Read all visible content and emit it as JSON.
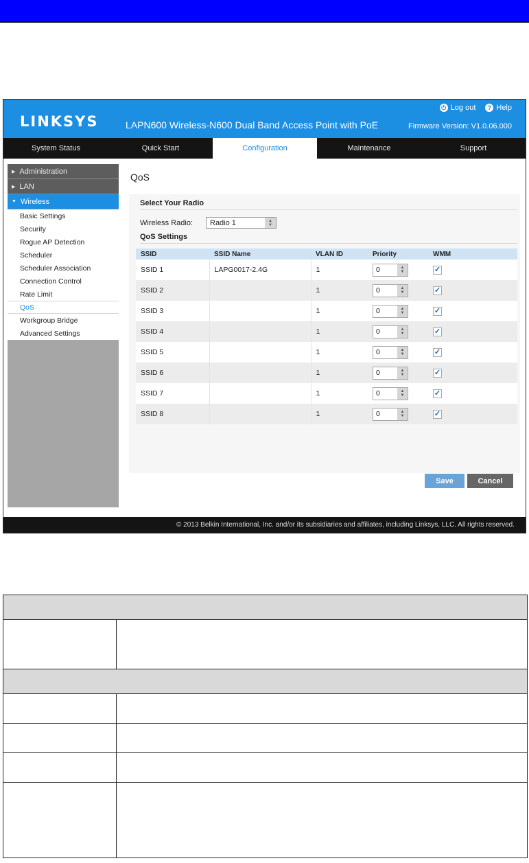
{
  "header": {
    "logo": "LINKSYS",
    "product_title": "LAPN600 Wireless-N600 Dual Band Access Point with PoE",
    "logout_label": "Log out",
    "help_label": "Help",
    "firmware": "Firmware Version: V1.0.06.000"
  },
  "nav": {
    "tabs": [
      "System Status",
      "Quick Start",
      "Configuration",
      "Maintenance",
      "Support"
    ],
    "active": "Configuration"
  },
  "sidebar": {
    "groups": [
      "Administration",
      "LAN",
      "Wireless"
    ],
    "items": [
      "Basic Settings",
      "Security",
      "Rogue AP Detection",
      "Scheduler",
      "Scheduler Association",
      "Connection Control",
      "Rate Limit",
      "QoS",
      "Workgroup Bridge",
      "Advanced Settings"
    ],
    "active_item": "QoS"
  },
  "main": {
    "page_title": "QoS",
    "select_radio_heading": "Select Your Radio",
    "wireless_radio_label": "Wireless Radio:",
    "wireless_radio_value": "Radio 1",
    "qos_heading": "QoS Settings",
    "columns": [
      "SSID",
      "SSID Name",
      "VLAN ID",
      "Priority",
      "WMM"
    ],
    "rows": [
      {
        "ssid": "SSID 1",
        "name": "LAPG0017-2.4G",
        "vlan": "1",
        "priority": "0",
        "wmm": true
      },
      {
        "ssid": "SSID 2",
        "name": "",
        "vlan": "1",
        "priority": "0",
        "wmm": true
      },
      {
        "ssid": "SSID 3",
        "name": "",
        "vlan": "1",
        "priority": "0",
        "wmm": true
      },
      {
        "ssid": "SSID 4",
        "name": "",
        "vlan": "1",
        "priority": "0",
        "wmm": true
      },
      {
        "ssid": "SSID 5",
        "name": "",
        "vlan": "1",
        "priority": "0",
        "wmm": true
      },
      {
        "ssid": "SSID 6",
        "name": "",
        "vlan": "1",
        "priority": "0",
        "wmm": true
      },
      {
        "ssid": "SSID 7",
        "name": "",
        "vlan": "1",
        "priority": "0",
        "wmm": true
      },
      {
        "ssid": "SSID 8",
        "name": "",
        "vlan": "1",
        "priority": "0",
        "wmm": true
      }
    ],
    "save_label": "Save",
    "cancel_label": "Cancel"
  },
  "footer": {
    "copyright": "© 2013 Belkin International, Inc. and/or its subsidiaries and affiliates, including Linksys, LLC. All rights reserved."
  },
  "colors": {
    "page_band": "#0000ff",
    "header_blue": "#1c8fe3",
    "nav_dark": "#141414",
    "sidebar_active": "#1c8fe3",
    "save_button": "#6aa3d8",
    "cancel_button": "#666666"
  }
}
